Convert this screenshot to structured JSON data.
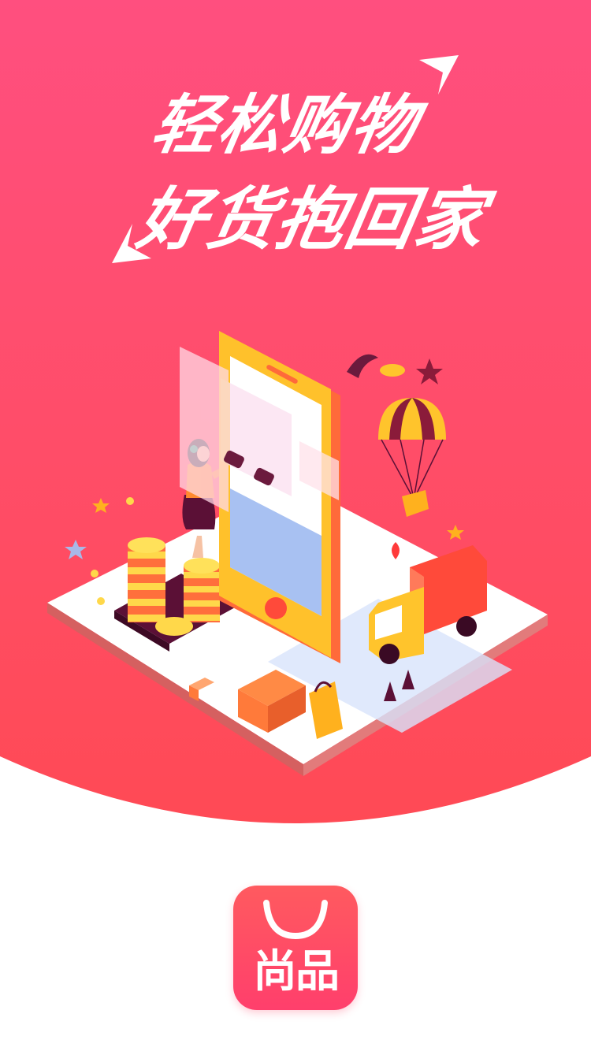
{
  "splash": {
    "slogan_line1": "轻松购物",
    "slogan_line2": "好货抱回家"
  },
  "app_logo": {
    "name": "尚品",
    "icon": "shopping-bag-handle-icon"
  },
  "colors": {
    "bg_top": "#ff4f7f",
    "bg_bottom": "#ff4a55",
    "logo_bg": "#ff4a62",
    "page_bg": "#ffffff"
  }
}
